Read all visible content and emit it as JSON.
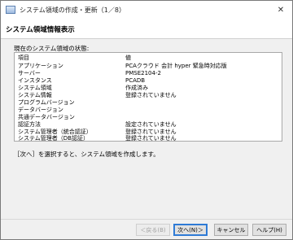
{
  "window": {
    "title": "システム領域の作成・更新（1／8）"
  },
  "header": {
    "title": "システム領域情報表示"
  },
  "status": {
    "section_label": "現在のシステム領域の状態:",
    "rows": [
      {
        "key": "項目",
        "value": "値"
      },
      {
        "key": "アプリケーション",
        "value": "PCAクラウド 会計 hyper 緊急時対応版"
      },
      {
        "key": "サーバー",
        "value": "PMSE2104-2"
      },
      {
        "key": "インスタンス",
        "value": "PCADB"
      },
      {
        "key": "システム領域",
        "value": "作成済み"
      },
      {
        "key": "システム情報",
        "value": "登録されていません"
      },
      {
        "key": "プログラムバージョン",
        "value": ""
      },
      {
        "key": "データバージョン",
        "value": ""
      },
      {
        "key": "共通データバージョン",
        "value": ""
      },
      {
        "key": "認証方法",
        "value": "設定されていません"
      },
      {
        "key": "システム管理者（統合認証）",
        "value": "登録されていません"
      },
      {
        "key": "システム管理者（DB認証）",
        "value": "登録されていません"
      }
    ]
  },
  "hint": "［次へ］を選択すると、システム領域を作成します。",
  "buttons": {
    "back": "＜戻る(B)",
    "next": "次へ(N)＞",
    "cancel": "キャンセル",
    "help": "ヘルプ(H)"
  }
}
